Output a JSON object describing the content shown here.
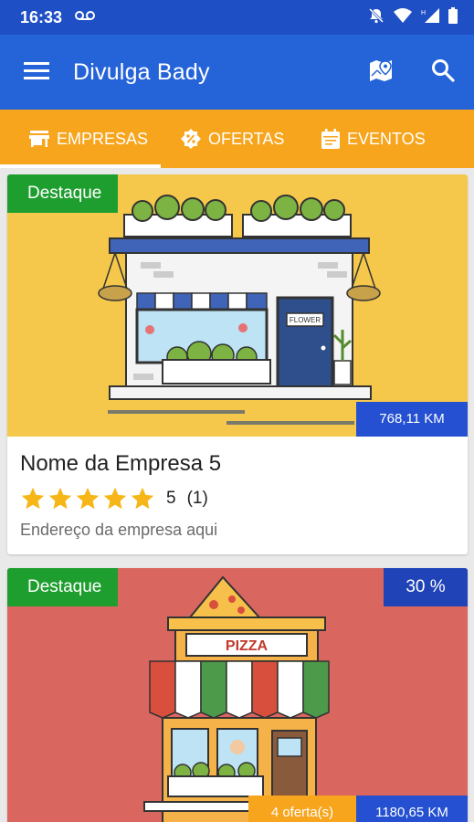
{
  "status_bar": {
    "time": "16:33",
    "voicemail_icon": "voicemail-icon",
    "icons": [
      "notifications-off-icon",
      "wifi-icon",
      "signal-icon",
      "battery-icon"
    ]
  },
  "app_bar": {
    "title": "Divulga Bady",
    "menu_icon": "menu-icon",
    "map_icon": "map-icon",
    "search_icon": "search-icon"
  },
  "tabs": [
    {
      "label": "EMPRESAS",
      "icon": "store-icon",
      "active": true
    },
    {
      "label": "OFERTAS",
      "icon": "discount-icon",
      "active": false
    },
    {
      "label": "EVENTOS",
      "icon": "calendar-icon",
      "active": false
    }
  ],
  "cards": [
    {
      "featured_label": "Destaque",
      "distance": "768,11 KM",
      "name": "Nome da Empresa 5",
      "rating": 5,
      "rating_value": "5",
      "rating_count": "(1)",
      "address": "Endereço da empresa aqui",
      "image_bg": "#f5c84c",
      "illustration": "flower-shop"
    },
    {
      "featured_label": "Destaque",
      "discount": "30 %",
      "offers": "4 oferta(s)",
      "distance": "1180,65 KM",
      "sign_text": "PIZZA",
      "image_bg": "#d9675f",
      "illustration": "pizza-shop"
    }
  ],
  "colors": {
    "status_bar": "#1f4fc4",
    "app_bar": "#2563d8",
    "tab_bar": "#f7a51d",
    "featured_badge": "#1e9e2f",
    "distance_badge": "#2450d1",
    "star": "#f7b617"
  }
}
